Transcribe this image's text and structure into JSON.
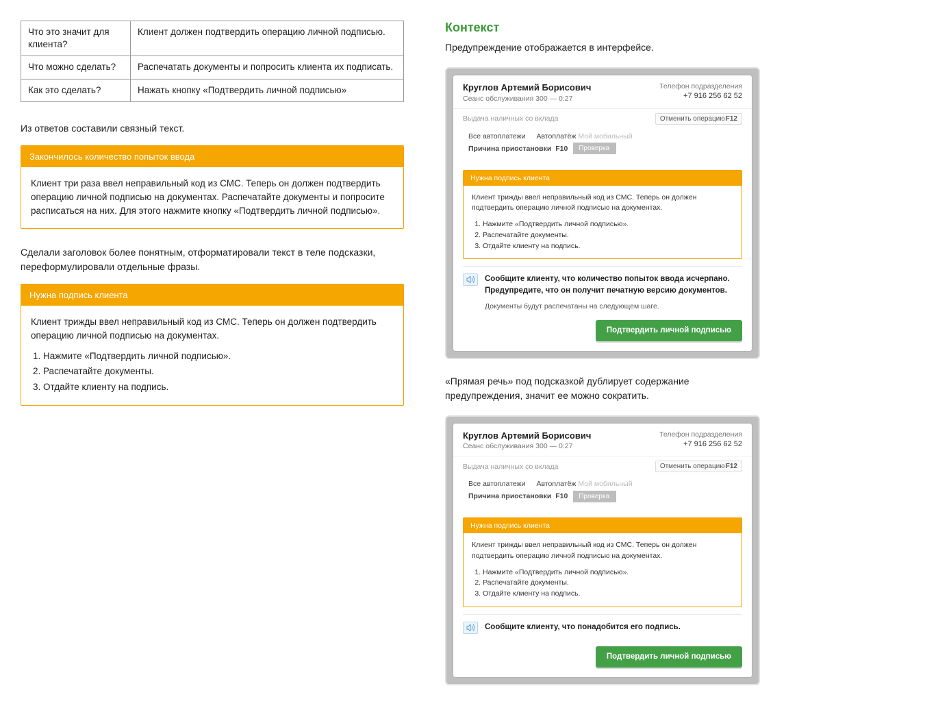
{
  "left": {
    "table": [
      {
        "q": "Что это значит для клиента?",
        "a": "Клиент должен подтвердить операцию личной подписью."
      },
      {
        "q": "Что можно сделать?",
        "a": "Распечатать документы и попросить клиента их подписать."
      },
      {
        "q": "Как это сделать?",
        "a": "Нажать кнопку «Подтвердить личной подписью»"
      }
    ],
    "intro1": "Из ответов составили связный текст.",
    "warn1": {
      "title": "Закончилось количество попыток ввода",
      "body": "Клиент три раза ввел неправильный код из СМС. Теперь он должен подтвердить операцию личной подписью на документах. Распечатайте документы и попросите расписаться на них. Для этого нажмите кнопку «Подтвердить личной подписью»."
    },
    "intro2": "Сделали заголовок более понятным, отформатировали текст в теле подсказки, переформулировали отдельные фразы.",
    "warn2": {
      "title": "Нужна подпись клиента",
      "lead": "Клиент трижды ввел неправильный код из СМС. Теперь он должен подтвердить операцию личной подписью на документах.",
      "steps": [
        "Нажмите «Подтвердить личной подписью».",
        "Распечатайте документы.",
        "Отдайте клиенту на подпись."
      ]
    }
  },
  "right": {
    "heading": "Контекст",
    "lead1": "Предупреждение отображается в интерфейсе.",
    "lead2": "«Прямая речь» под подсказкой дублирует содержание предупреждения, значит ее можно сократить.",
    "client": {
      "name": "Круглов Артемий Борисович",
      "session": "Сеанс обслуживания 300 — 0:27",
      "phone_label": "Телефон подразделения",
      "phone": "+7 916 256 62 52",
      "operation": "Выдача наличных со вклада",
      "cancel_label": "Отменить операцию",
      "cancel_key": "F12",
      "crumbs": {
        "c1": "Все автоплатежи",
        "c2a": "Автоплатёж",
        "c2b": "Мой мобильный",
        "c3": "Причина приостановки",
        "c3key": "F10",
        "c4": "Проверка"
      }
    },
    "mini": {
      "title": "Нужна подпись клиента",
      "lead": "Клиент трижды ввел неправильный код из СМС. Теперь он должен подтвердить операцию личной подписью на документах.",
      "steps": [
        "Нажмите «Подтвердить личной подписью».",
        "Распечатайте документы.",
        "Отдайте клиенту на подпись."
      ]
    },
    "callout1": {
      "msg": "Сообщите клиенту, что количество попыток ввода исчерпано. Предупредите, что он получит печатную версию документов.",
      "sub": "Документы будут распечатаны на следующем шаге."
    },
    "callout2": {
      "msg": "Сообщите клиенту, что понадобится его подпись."
    },
    "confirm_btn": "Подтвердить личной подписью"
  }
}
